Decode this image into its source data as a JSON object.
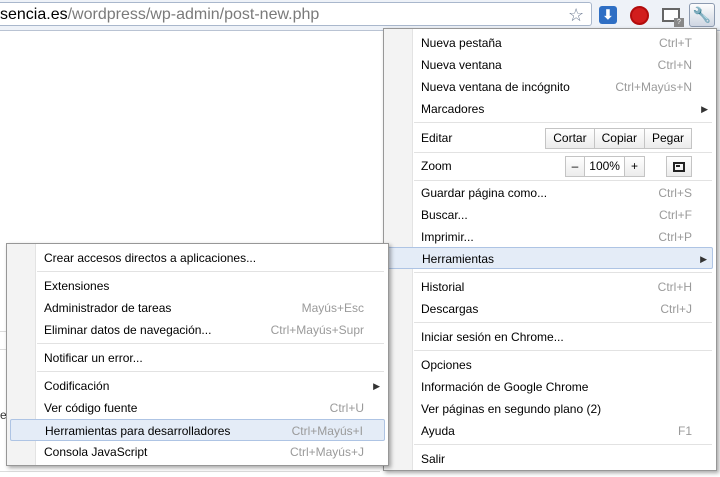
{
  "toolbar": {
    "url_host": "sencia.es",
    "url_path": "/wordpress/wp-admin/post-new.php",
    "star": "☆",
    "download_ext": "⬇",
    "stop_ext": "STOP",
    "mail_badge": "?",
    "wrench": "🔧"
  },
  "page": {
    "fragment": "e"
  },
  "main_menu": {
    "new_tab": {
      "label": "Nueva pestaña",
      "shortcut": "Ctrl+T"
    },
    "new_window": {
      "label": "Nueva ventana",
      "shortcut": "Ctrl+N"
    },
    "incognito": {
      "label": "Nueva ventana de incógnito",
      "shortcut": "Ctrl+Mayús+N"
    },
    "bookmarks": {
      "label": "Marcadores"
    },
    "edit": {
      "label": "Editar",
      "cut": "Cortar",
      "copy": "Copiar",
      "paste": "Pegar"
    },
    "zoom": {
      "label": "Zoom",
      "minus": "–",
      "value": "100%",
      "plus": "+"
    },
    "save_page": {
      "label": "Guardar página como...",
      "shortcut": "Ctrl+S"
    },
    "find": {
      "label": "Buscar...",
      "shortcut": "Ctrl+F"
    },
    "print": {
      "label": "Imprimir...",
      "shortcut": "Ctrl+P"
    },
    "tools": {
      "label": "Herramientas"
    },
    "history": {
      "label": "Historial",
      "shortcut": "Ctrl+H"
    },
    "downloads": {
      "label": "Descargas",
      "shortcut": "Ctrl+J"
    },
    "sign_in": {
      "label": "Iniciar sesión en Chrome..."
    },
    "options": {
      "label": "Opciones"
    },
    "about": {
      "label": "Información de Google Chrome"
    },
    "background": {
      "label": "Ver páginas en segundo plano (2)"
    },
    "help": {
      "label": "Ayuda",
      "shortcut": "F1"
    },
    "exit": {
      "label": "Salir"
    }
  },
  "tools_menu": {
    "app_shortcuts": {
      "label": "Crear accesos directos a aplicaciones..."
    },
    "extensions": {
      "label": "Extensiones"
    },
    "task_manager": {
      "label": "Administrador de tareas",
      "shortcut": "Mayús+Esc"
    },
    "clear_data": {
      "label": "Eliminar datos de navegación...",
      "shortcut": "Ctrl+Mayús+Supr"
    },
    "report_issue": {
      "label": "Notificar un error..."
    },
    "encoding": {
      "label": "Codificación"
    },
    "view_source": {
      "label": "Ver código fuente",
      "shortcut": "Ctrl+U"
    },
    "dev_tools": {
      "label": "Herramientas para desarrolladores",
      "shortcut": "Ctrl+Mayús+I"
    },
    "js_console": {
      "label": "Consola JavaScript",
      "shortcut": "Ctrl+Mayús+J"
    }
  }
}
